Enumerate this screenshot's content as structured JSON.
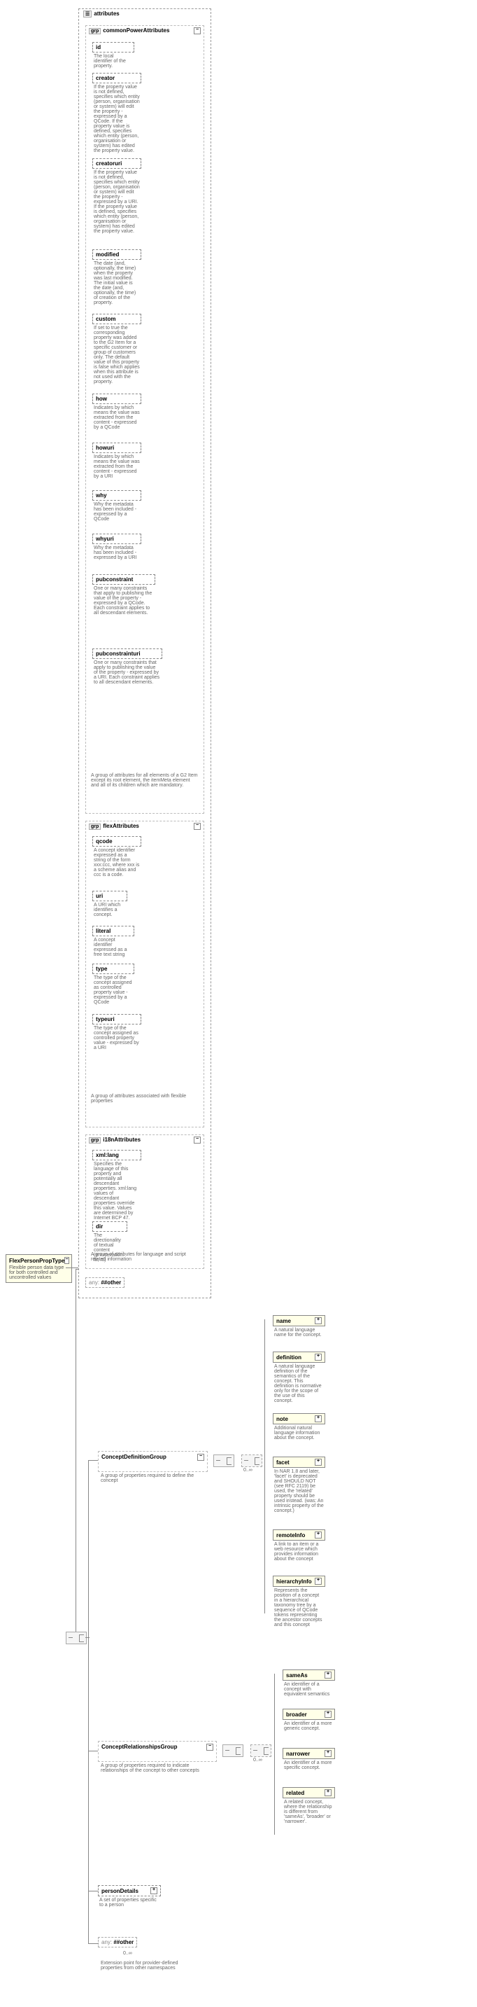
{
  "root": {
    "title": "FlexPersonPropType",
    "desc": "Flexible person data type for both controlled and uncontrolled values"
  },
  "attributesBox": {
    "label": "attributes"
  },
  "groups": {
    "commonPower": {
      "badge": "grp",
      "title": "commonPowerAttributes",
      "desc": "A group of attributes for all elements of a G2 Item except its root element, the itemMeta element and all of its children which are mandatory."
    },
    "flex": {
      "badge": "grp",
      "title": "flexAttributes",
      "desc": "A group of attributes associated with flexible properties"
    },
    "i18n": {
      "badge": "grp",
      "title": "i18nAttributes",
      "desc": "A group of attributes for language and script related information"
    }
  },
  "attrs": {
    "id": {
      "name": "id",
      "desc": "The local identifier of the property."
    },
    "creator": {
      "name": "creator",
      "desc": "If the property value is not defined, specifies which entity (person, organisation or system) will edit the property - expressed by a QCode. If the property value is defined, specifies which entity (person, organisation or system) has edited the property value."
    },
    "creatoruri": {
      "name": "creatoruri",
      "desc": "If the property value is not defined, specifies which entity (person, organisation or system) will edit the property - expressed by a URI. If the property value is defined, specifies which entity (person, organisation or system) has edited the property value."
    },
    "modified": {
      "name": "modified",
      "desc": "The date (and, optionally, the time) when the property was last modified. The initial value is the date (and, optionally, the time) of creation of the property."
    },
    "custom": {
      "name": "custom",
      "desc": "If set to true the corresponding property was added to the G2 Item for a specific customer or group of customers only. The default value of this property is false which applies when this attribute is not used with the property."
    },
    "how": {
      "name": "how",
      "desc": "Indicates by which means the value was extracted from the content - expressed by a QCode"
    },
    "howuri": {
      "name": "howuri",
      "desc": "Indicates by which means the value was extracted from the content - expressed by a URI"
    },
    "why": {
      "name": "why",
      "desc": "Why the metadata has been included - expressed by a QCode"
    },
    "whyuri": {
      "name": "whyuri",
      "desc": "Why the metadata has been included - expressed by a URI"
    },
    "pubconstraint": {
      "name": "pubconstraint",
      "desc": "One or many constraints that apply to publishing the value of the property - expressed by a QCode. Each constraint applies to all descendant elements."
    },
    "pubconstrainturi": {
      "name": "pubconstrainturi",
      "desc": "One or many constraints that apply to publishing the value of the property - expressed by a URI. Each constraint applies to all descendant elements."
    },
    "qcode": {
      "name": "qcode",
      "desc": "A concept identifier expressed as a string of the form xxx:ccc, where xxx is a scheme alias and ccc is a code."
    },
    "uri": {
      "name": "uri",
      "desc": "A URI which identifies a concept."
    },
    "literal": {
      "name": "literal",
      "desc": "A concept identifier expressed as a free text string"
    },
    "type": {
      "name": "type",
      "desc": "The type of the concept assigned as controlled property value - expressed by a QCode"
    },
    "typeuri": {
      "name": "typeuri",
      "desc": "The type of the concept assigned as controlled property value - expressed by a URI"
    },
    "xmllang": {
      "name": "xml:lang",
      "desc": "Specifies the language of this property and potentially all descendant properties. xml:lang values of descendant properties override this value. Values are determined by Internet BCP 47."
    },
    "dir": {
      "name": "dir",
      "desc": "The directionality of textual content (enumeration: ltr, rtl)"
    }
  },
  "anyOther": {
    "label": "##other",
    "prefix": "any:"
  },
  "conceptDef": {
    "title": "ConceptDefinitionGroup",
    "desc": "A group of properties required to define the concept",
    "card": "0..∞"
  },
  "conceptRel": {
    "title": "ConceptRelationshipsGroup",
    "desc": "A group of properties required to indicate relationships of the concept to other concepts",
    "card": "0..∞"
  },
  "personDetails": {
    "title": "personDetails",
    "desc": "A set of properties specific to a person"
  },
  "anyBottom": {
    "label": "##other",
    "prefix": "any:",
    "card": "0..∞",
    "desc": "Extension point for provider-defined properties from other namespaces"
  },
  "defEls": {
    "name": {
      "name": "name",
      "desc": "A natural language name for the concept."
    },
    "definition": {
      "name": "definition",
      "desc": "A natural language definition of the semantics of the concept. This definition is normative only for the scope of the use of this concept."
    },
    "note": {
      "name": "note",
      "desc": "Additional natural language information about the concept."
    },
    "facet": {
      "name": "facet",
      "desc": "In NAR 1.8 and later, 'facet' is deprecated and SHOULD NOT (see RFC 2119) be used, the 'related' property should be used instead. (was: An intrinsic property of the concept.)"
    },
    "remoteInfo": {
      "name": "remoteInfo",
      "desc": "A link to an item or a web resource which provides information about the concept"
    },
    "hierarchyInfo": {
      "name": "hierarchyInfo",
      "desc": "Represents the position of a concept in a hierarchical taxonomy tree by a sequence of QCode tokens representing the ancestor concepts and this concept"
    }
  },
  "relEls": {
    "sameAs": {
      "name": "sameAs",
      "desc": "An identifier of a concept with equivalent semantics"
    },
    "broader": {
      "name": "broader",
      "desc": "An identifier of a more generic concept."
    },
    "narrower": {
      "name": "narrower",
      "desc": "An identifier of a more specific concept."
    },
    "related": {
      "name": "related",
      "desc": "A related concept, where the relationship is different from 'sameAs', 'broader' or 'narrower'."
    }
  }
}
